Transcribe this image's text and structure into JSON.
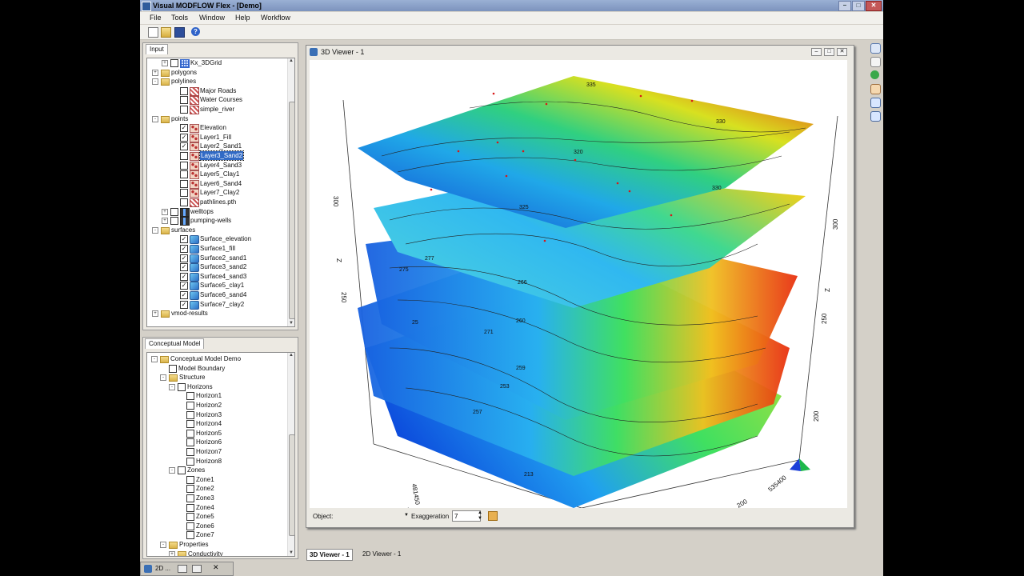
{
  "window": {
    "title": "Visual MODFLOW Flex - [Demo]",
    "controls": [
      "–",
      "□",
      "✕"
    ]
  },
  "menu": [
    "File",
    "Tools",
    "Window",
    "Help",
    "Workflow"
  ],
  "toolbar": {
    "icons": [
      "new-file-icon",
      "open-folder-icon",
      "save-icon",
      "help-icon"
    ]
  },
  "input_panel": {
    "tab": "Input",
    "items": [
      {
        "label": "Kx_3DGrid",
        "icon": "grid",
        "checked": false,
        "depth": 1,
        "exp": "+"
      },
      {
        "label": "polygons",
        "icon": "folder",
        "checked": null,
        "depth": 0,
        "exp": "+"
      },
      {
        "label": "polylines",
        "icon": "folder",
        "checked": null,
        "depth": 0,
        "exp": "–"
      },
      {
        "label": "Major Roads",
        "icon": "poly",
        "checked": false,
        "depth": 2,
        "exp": null
      },
      {
        "label": "Water Courses",
        "icon": "poly",
        "checked": false,
        "depth": 2,
        "exp": null
      },
      {
        "label": "simple_river",
        "icon": "poly",
        "checked": false,
        "depth": 2,
        "exp": null
      },
      {
        "label": "points",
        "icon": "folder",
        "checked": null,
        "depth": 0,
        "exp": "–"
      },
      {
        "label": "Elevation",
        "icon": "pts",
        "checked": true,
        "depth": 2,
        "exp": null
      },
      {
        "label": "Layer1_Fill",
        "icon": "pts",
        "checked": true,
        "depth": 2,
        "exp": null
      },
      {
        "label": "Layer2_Sand1",
        "icon": "pts",
        "checked": true,
        "depth": 2,
        "exp": null
      },
      {
        "label": "Layer3_Sand2",
        "icon": "pts",
        "checked": false,
        "depth": 2,
        "exp": null,
        "selected": true
      },
      {
        "label": "Layer4_Sand3",
        "icon": "pts",
        "checked": false,
        "depth": 2,
        "exp": null
      },
      {
        "label": "Layer5_Clay1",
        "icon": "pts",
        "checked": false,
        "depth": 2,
        "exp": null
      },
      {
        "label": "Layer6_Sand4",
        "icon": "pts",
        "checked": false,
        "depth": 2,
        "exp": null
      },
      {
        "label": "Layer7_Clay2",
        "icon": "pts",
        "checked": false,
        "depth": 2,
        "exp": null
      },
      {
        "label": "pathlines.pth",
        "icon": "poly",
        "checked": false,
        "depth": 2,
        "exp": null
      },
      {
        "label": "welltops",
        "icon": "well",
        "checked": false,
        "depth": 1,
        "exp": "+"
      },
      {
        "label": "pumping-wells",
        "icon": "well",
        "checked": false,
        "depth": 1,
        "exp": "+"
      },
      {
        "label": "surfaces",
        "icon": "folder",
        "checked": null,
        "depth": 0,
        "exp": "–"
      },
      {
        "label": "Surface_elevation",
        "icon": "surf",
        "checked": true,
        "depth": 2,
        "exp": null
      },
      {
        "label": "Surface1_fill",
        "icon": "surf",
        "checked": true,
        "depth": 2,
        "exp": null
      },
      {
        "label": "Surface2_sand1",
        "icon": "surf",
        "checked": true,
        "depth": 2,
        "exp": null
      },
      {
        "label": "Surface3_sand2",
        "icon": "surf",
        "checked": true,
        "depth": 2,
        "exp": null
      },
      {
        "label": "Surface4_sand3",
        "icon": "surf",
        "checked": true,
        "depth": 2,
        "exp": null
      },
      {
        "label": "Surface5_clay1",
        "icon": "surf",
        "checked": true,
        "depth": 2,
        "exp": null
      },
      {
        "label": "Surface6_sand4",
        "icon": "surf",
        "checked": true,
        "depth": 2,
        "exp": null
      },
      {
        "label": "Surface7_clay2",
        "icon": "surf",
        "checked": true,
        "depth": 2,
        "exp": null
      },
      {
        "label": "vmod-results",
        "icon": "folder",
        "checked": null,
        "depth": 0,
        "exp": "+"
      }
    ]
  },
  "model_panel": {
    "tab": "Conceptual Model",
    "items": [
      {
        "label": "Conceptual Model Demo",
        "depth": 0,
        "exp": "–",
        "icon": "folder",
        "checked": null
      },
      {
        "label": "Model Boundary",
        "depth": 1,
        "exp": null,
        "icon": null,
        "checked": false
      },
      {
        "label": "Structure",
        "depth": 1,
        "exp": "–",
        "icon": "folder",
        "checked": null
      },
      {
        "label": "Horizons",
        "depth": 2,
        "exp": "–",
        "icon": null,
        "checked": false
      },
      {
        "label": "Horizon1",
        "depth": 3,
        "exp": null,
        "icon": null,
        "checked": false
      },
      {
        "label": "Horizon2",
        "depth": 3,
        "exp": null,
        "icon": null,
        "checked": false
      },
      {
        "label": "Horizon3",
        "depth": 3,
        "exp": null,
        "icon": null,
        "checked": false
      },
      {
        "label": "Horizon4",
        "depth": 3,
        "exp": null,
        "icon": null,
        "checked": false
      },
      {
        "label": "Horizon5",
        "depth": 3,
        "exp": null,
        "icon": null,
        "checked": false
      },
      {
        "label": "Horizon6",
        "depth": 3,
        "exp": null,
        "icon": null,
        "checked": false
      },
      {
        "label": "Horizon7",
        "depth": 3,
        "exp": null,
        "icon": null,
        "checked": false
      },
      {
        "label": "Horizon8",
        "depth": 3,
        "exp": null,
        "icon": null,
        "checked": false
      },
      {
        "label": "Zones",
        "depth": 2,
        "exp": "–",
        "icon": null,
        "checked": false
      },
      {
        "label": "Zone1",
        "depth": 3,
        "exp": null,
        "icon": null,
        "checked": false
      },
      {
        "label": "Zone2",
        "depth": 3,
        "exp": null,
        "icon": null,
        "checked": false
      },
      {
        "label": "Zone3",
        "depth": 3,
        "exp": null,
        "icon": null,
        "checked": false
      },
      {
        "label": "Zone4",
        "depth": 3,
        "exp": null,
        "icon": null,
        "checked": false
      },
      {
        "label": "Zone5",
        "depth": 3,
        "exp": null,
        "icon": null,
        "checked": false
      },
      {
        "label": "Zone6",
        "depth": 3,
        "exp": null,
        "icon": null,
        "checked": false
      },
      {
        "label": "Zone7",
        "depth": 3,
        "exp": null,
        "icon": null,
        "checked": false
      },
      {
        "label": "Properties",
        "depth": 1,
        "exp": "–",
        "icon": "folder",
        "checked": null
      },
      {
        "label": "Conductivity",
        "depth": 2,
        "exp": "+",
        "icon": "folder",
        "checked": null
      }
    ]
  },
  "viewer": {
    "title": "3D Viewer - 1",
    "axis_labels": {
      "z_left_ticks": [
        "300",
        "250"
      ],
      "z_right_ticks": [
        "300",
        "250",
        "200"
      ],
      "z_axis": "Z",
      "x_ticks": [
        "535400",
        "200"
      ],
      "y_ticks": [
        "481450",
        "Y"
      ]
    },
    "contour_labels": [
      "335",
      "330",
      "320",
      "325",
      "275",
      "277",
      "266",
      "260",
      "271",
      "259",
      "253",
      "257",
      "213",
      "25"
    ],
    "object_label": "Object:",
    "exaggeration_label": "Exaggeration",
    "exaggeration_value": "7"
  },
  "right_tools": [
    "view-tool-icon",
    "pointer-icon",
    "rotate-icon",
    "pan-hand-icon",
    "zoom-in-icon",
    "zoom-out-icon"
  ],
  "bottom_tabs": [
    {
      "label": "3D Viewer - 1",
      "active": true
    },
    {
      "label": "2D Viewer - 1",
      "active": false
    }
  ],
  "taskbar": {
    "label": "2D ..."
  }
}
